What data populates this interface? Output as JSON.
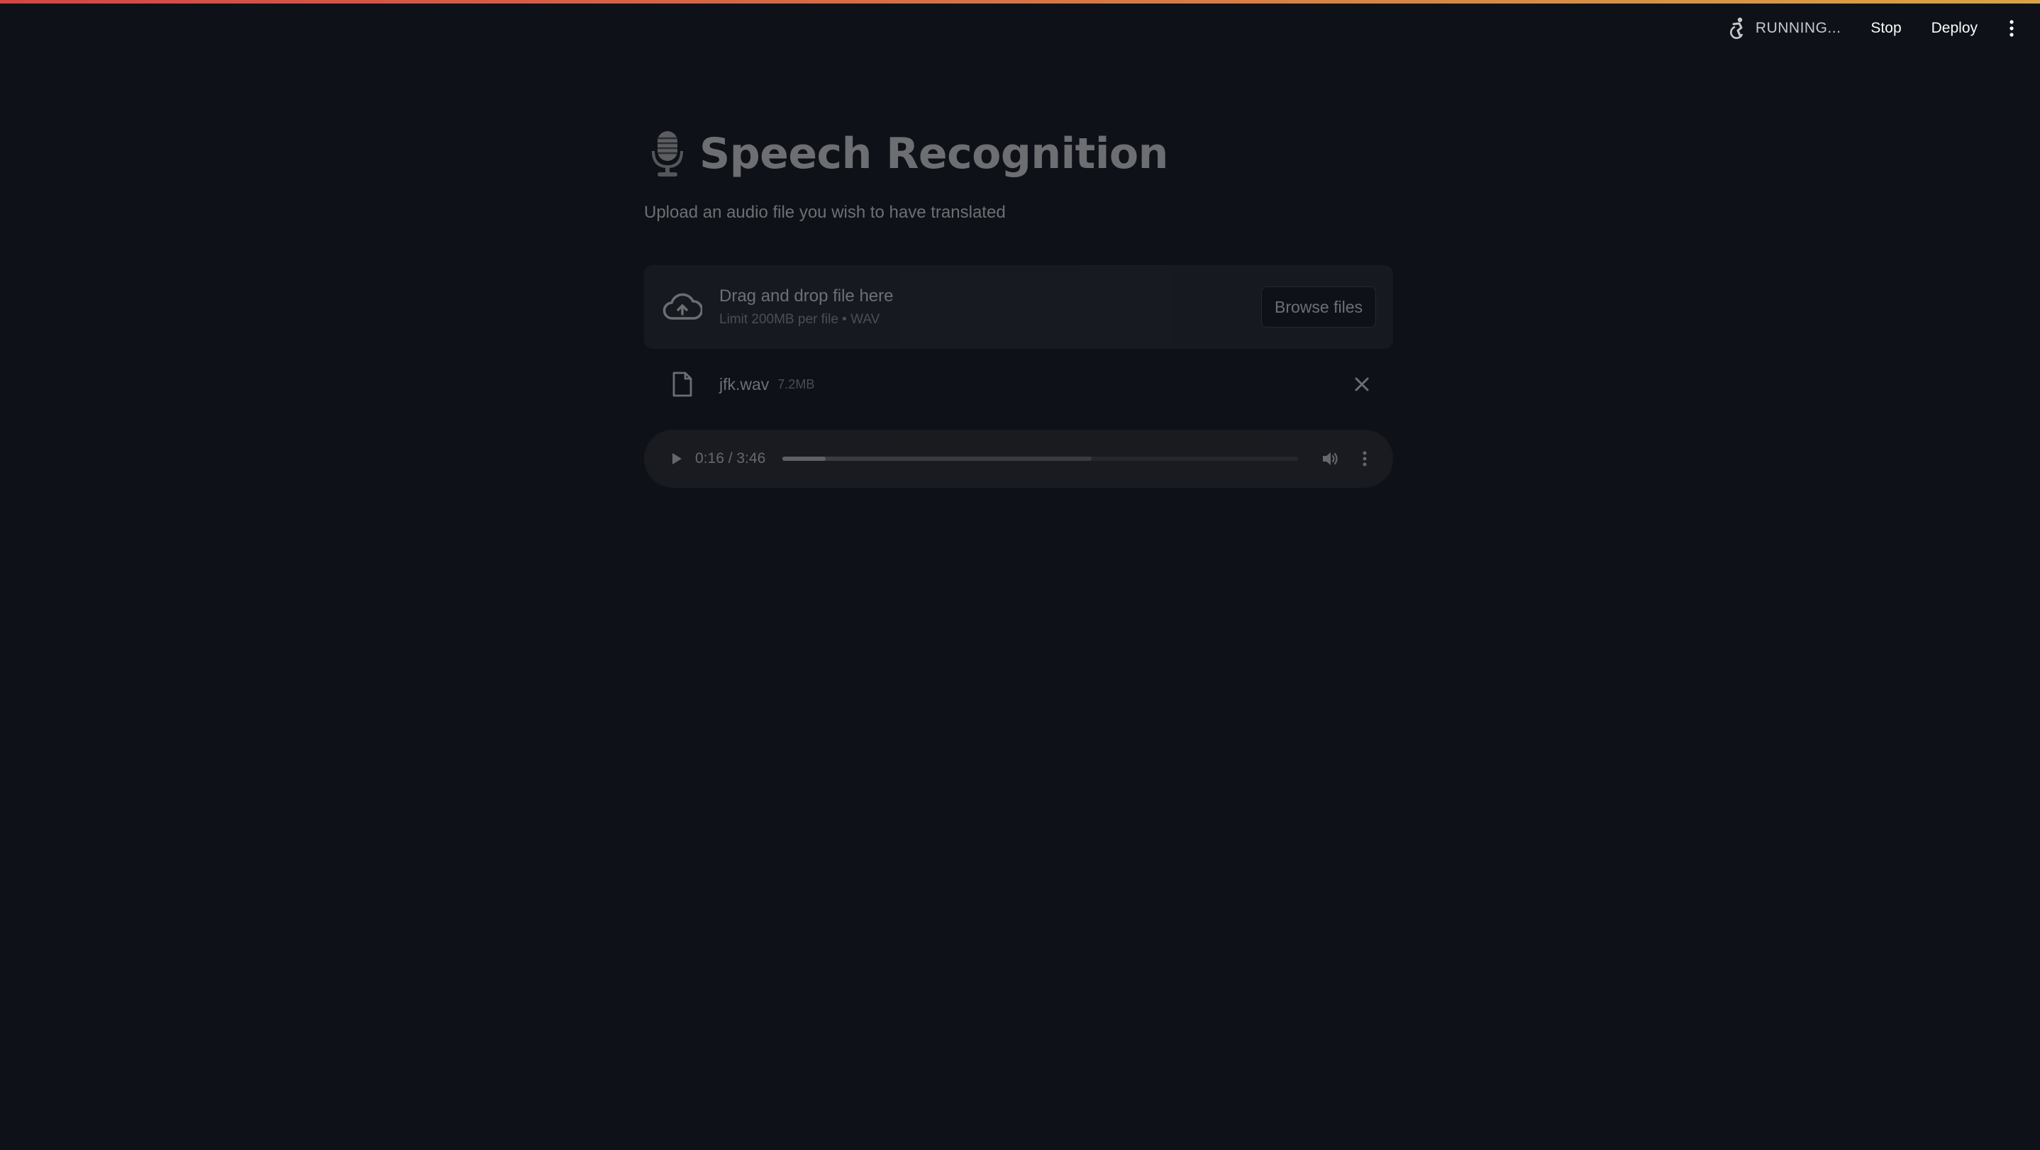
{
  "toolbar": {
    "status_icon": "running-figure-icon",
    "status_text": "RUNNING...",
    "stop_label": "Stop",
    "deploy_label": "Deploy",
    "menu_icon": "vertical-dots-icon"
  },
  "header": {
    "title_icon": "microphone-icon",
    "title": "Speech Recognition",
    "subtitle": "Upload an audio file you wish to have translated"
  },
  "uploader": {
    "icon": "cloud-upload-icon",
    "drop_text": "Drag and drop file here",
    "limit_text": "Limit 200MB per file • WAV",
    "browse_label": "Browse files"
  },
  "file": {
    "icon": "file-icon",
    "name": "jfk.wav",
    "size": "7.2MB",
    "remove_icon": "close-icon"
  },
  "player": {
    "time": "0:16 / 3:46",
    "played_fraction": 0.084,
    "buffered_fraction": 0.6,
    "icons": [
      "play-icon",
      "volume-icon",
      "more-options-icon"
    ]
  },
  "colors": {
    "background": "#0e1117",
    "accent_gradient_start": "#ff4b4b",
    "accent_gradient_end": "#ffbd45",
    "panel": "#262730"
  }
}
